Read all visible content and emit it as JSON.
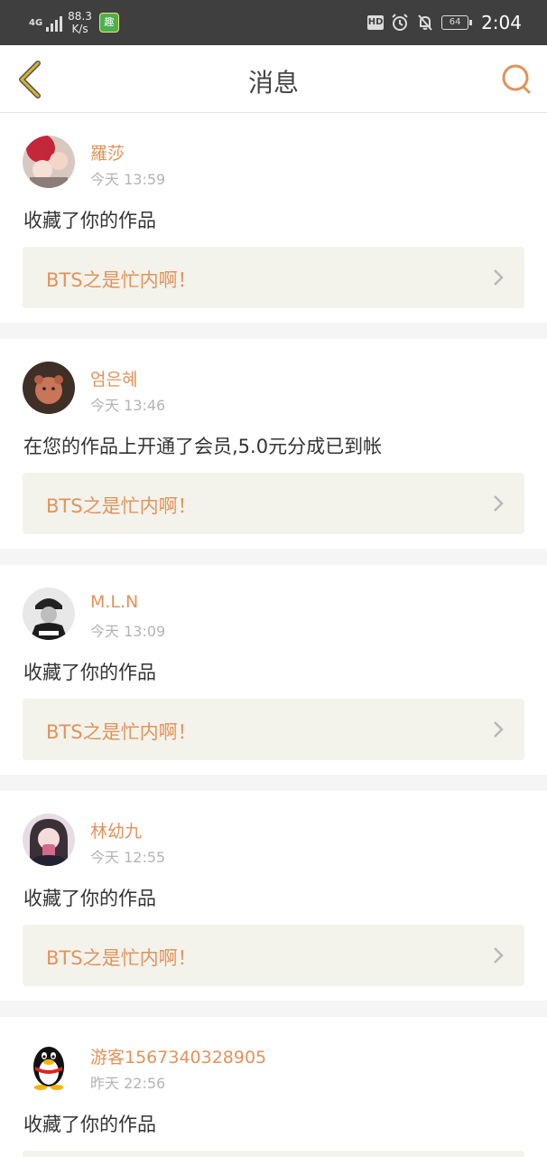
{
  "status_bar": {
    "network": "4G",
    "speed_value": "88.3",
    "speed_unit": "K/s",
    "app_icon_text": "趣",
    "hd": "HD",
    "battery": "64",
    "time": "2:04"
  },
  "nav": {
    "title": "消息",
    "back_icon": "chevron-left-icon",
    "search_icon": "search-icon"
  },
  "colors": {
    "accent": "#e3925a",
    "back_icon": "#d8b42c",
    "card_link_bg": "#f3f3ec"
  },
  "messages": [
    {
      "name": "羅莎",
      "time": "今天 13:59",
      "text": "收藏了你的作品",
      "work": "BTS之是忙内啊！"
    },
    {
      "name": "엄은혜",
      "time": "今天 13:46",
      "text": "在您的作品上开通了会员,5.0元分成已到帐",
      "work": "BTS之是忙内啊！"
    },
    {
      "name": "M.L.N",
      "time": "今天 13:09",
      "text": "收藏了你的作品",
      "work": "BTS之是忙内啊！"
    },
    {
      "name": "林幼九",
      "time": "今天 12:55",
      "text": "收藏了你的作品",
      "work": "BTS之是忙内啊！"
    },
    {
      "name": "游客1567340328905",
      "time": "昨天 22:56",
      "text": "收藏了你的作品",
      "work": ""
    }
  ]
}
